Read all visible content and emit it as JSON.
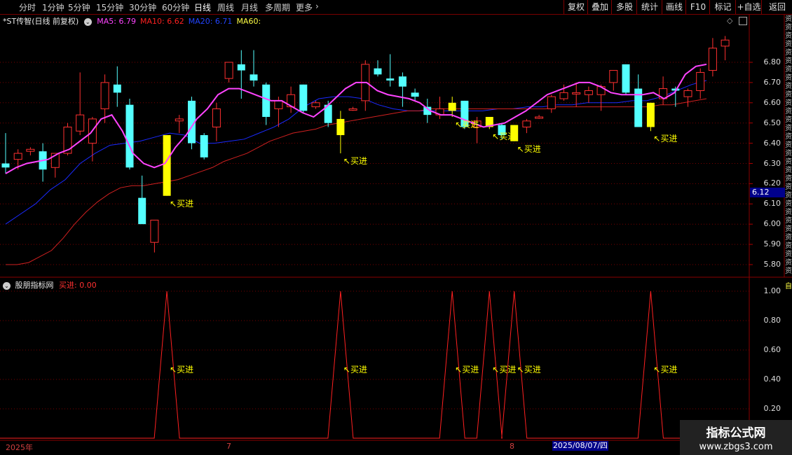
{
  "toolbar": {
    "timeframes": [
      "分时",
      "1分钟",
      "5分钟",
      "15分钟",
      "30分钟",
      "60分钟",
      "日线",
      "周线",
      "月线",
      "多周期",
      "更多"
    ],
    "right_buttons": [
      "复权",
      "叠加",
      "多股",
      "统计",
      "画线",
      "F10",
      "标记",
      "+自选",
      "返回"
    ]
  },
  "main_panel": {
    "stock_title": "*ST传智(日线 前复权)",
    "ma_legend": [
      {
        "label": "MA5: 6.79",
        "color": "#ff44ff"
      },
      {
        "label": "MA10: 6.62",
        "color": "#ff2020"
      },
      {
        "label": "MA20: 6.71",
        "color": "#2244ff"
      },
      {
        "label": "MA60:",
        "color": "#ffff44"
      }
    ],
    "price_axis": [
      "6.80",
      "6.70",
      "6.60",
      "6.50",
      "6.40",
      "6.30",
      "6.20",
      "6.10",
      "6.00",
      "5.90",
      "5.80"
    ],
    "current_price": "6.12",
    "buy_label": "↖买进",
    "right_edge_text": "资资资资资资资资资资资资资资资资资资资资资资资资资资资资资资资"
  },
  "indicator_panel": {
    "title": "股朋指标网",
    "signal_label": "买进: 0.00",
    "axis": [
      "1.00",
      "0.80",
      "0.60",
      "0.40",
      "0.20"
    ],
    "buy_label": "↖买进",
    "right_edge_text": "自"
  },
  "date_axis": {
    "labels": [
      "2025年",
      "7",
      "8"
    ],
    "highlight": "2025/08/07/四"
  },
  "watermark": {
    "line1": "指标公式网",
    "line2": "www.zbgs3.com"
  },
  "colors": {
    "up": "#ff3030",
    "down": "#54ffff",
    "signal": "#ffff00",
    "ma5": "#ff44ff",
    "ma10": "#d02020",
    "ma20": "#1a2aff",
    "grid": "#7a0000"
  },
  "chart_data": {
    "type": "candlestick",
    "candles": [
      {
        "o": 6.3,
        "h": 6.45,
        "l": 6.25,
        "c": 6.28
      },
      {
        "o": 6.32,
        "h": 6.37,
        "l": 6.27,
        "c": 6.35
      },
      {
        "o": 6.36,
        "h": 6.38,
        "l": 6.34,
        "c": 6.37
      },
      {
        "o": 6.36,
        "h": 6.4,
        "l": 6.21,
        "c": 6.27
      },
      {
        "o": 6.28,
        "h": 6.35,
        "l": 6.23,
        "c": 6.35
      },
      {
        "o": 6.35,
        "h": 6.5,
        "l": 6.34,
        "c": 6.48
      },
      {
        "o": 6.46,
        "h": 6.75,
        "l": 6.44,
        "c": 6.54
      },
      {
        "o": 6.4,
        "h": 6.53,
        "l": 6.31,
        "c": 6.52
      },
      {
        "o": 6.57,
        "h": 6.74,
        "l": 6.5,
        "c": 6.7
      },
      {
        "o": 6.69,
        "h": 6.78,
        "l": 6.58,
        "c": 6.65
      },
      {
        "o": 6.59,
        "h": 6.62,
        "l": 6.27,
        "c": 6.28
      },
      {
        "o": 6.13,
        "h": 6.24,
        "l": 6.02,
        "c": 6.0
      },
      {
        "o": 5.91,
        "h": 6.02,
        "l": 5.86,
        "c": 6.02
      },
      {
        "o": 6.44,
        "h": 6.44,
        "l": 6.14,
        "c": 6.14,
        "signal": true
      },
      {
        "o": 6.51,
        "h": 6.54,
        "l": 6.45,
        "c": 6.52
      },
      {
        "o": 6.61,
        "h": 6.63,
        "l": 6.37,
        "c": 6.4
      },
      {
        "o": 6.44,
        "h": 6.45,
        "l": 6.32,
        "c": 6.33
      },
      {
        "o": 6.48,
        "h": 6.6,
        "l": 6.41,
        "c": 6.57
      },
      {
        "o": 6.72,
        "h": 6.8,
        "l": 6.7,
        "c": 6.8
      },
      {
        "o": 6.79,
        "h": 6.86,
        "l": 6.62,
        "c": 6.76
      },
      {
        "o": 6.74,
        "h": 6.86,
        "l": 6.68,
        "c": 6.71
      },
      {
        "o": 6.69,
        "h": 6.7,
        "l": 6.49,
        "c": 6.53
      },
      {
        "o": 6.57,
        "h": 6.63,
        "l": 6.48,
        "c": 6.61
      },
      {
        "o": 6.58,
        "h": 6.68,
        "l": 6.55,
        "c": 6.64
      },
      {
        "o": 6.69,
        "h": 6.69,
        "l": 6.55,
        "c": 6.56
      },
      {
        "o": 6.58,
        "h": 6.61,
        "l": 6.57,
        "c": 6.6
      },
      {
        "o": 6.59,
        "h": 6.61,
        "l": 6.48,
        "c": 6.5
      },
      {
        "o": 6.52,
        "h": 6.56,
        "l": 6.35,
        "c": 6.44,
        "signal": true
      },
      {
        "o": 6.57,
        "h": 6.58,
        "l": 6.56,
        "c": 6.57
      },
      {
        "o": 6.61,
        "h": 6.81,
        "l": 6.56,
        "c": 6.79
      },
      {
        "o": 6.77,
        "h": 6.81,
        "l": 6.73,
        "c": 6.74
      },
      {
        "o": 6.72,
        "h": 6.84,
        "l": 6.68,
        "c": 6.71
      },
      {
        "o": 6.73,
        "h": 6.75,
        "l": 6.58,
        "c": 6.68
      },
      {
        "o": 6.65,
        "h": 6.67,
        "l": 6.61,
        "c": 6.63
      },
      {
        "o": 6.58,
        "h": 6.62,
        "l": 6.5,
        "c": 6.54
      },
      {
        "o": 6.54,
        "h": 6.63,
        "l": 6.52,
        "c": 6.57
      },
      {
        "o": 6.6,
        "h": 6.63,
        "l": 6.53,
        "c": 6.56,
        "signal": true
      },
      {
        "o": 6.61,
        "h": 6.61,
        "l": 6.47,
        "c": 6.48
      },
      {
        "o": 6.48,
        "h": 6.53,
        "l": 6.4,
        "c": 6.51
      },
      {
        "o": 6.53,
        "h": 6.53,
        "l": 6.47,
        "c": 6.48,
        "signal": true
      },
      {
        "o": 6.49,
        "h": 6.5,
        "l": 6.42,
        "c": 6.44
      },
      {
        "o": 6.49,
        "h": 6.49,
        "l": 6.41,
        "c": 6.41,
        "signal": true
      },
      {
        "o": 6.48,
        "h": 6.52,
        "l": 6.45,
        "c": 6.51
      },
      {
        "o": 6.53,
        "h": 6.54,
        "l": 6.52,
        "c": 6.53
      },
      {
        "o": 6.57,
        "h": 6.64,
        "l": 6.55,
        "c": 6.63
      },
      {
        "o": 6.62,
        "h": 6.69,
        "l": 6.61,
        "c": 6.65
      },
      {
        "o": 6.65,
        "h": 6.7,
        "l": 6.58,
        "c": 6.65
      },
      {
        "o": 6.64,
        "h": 6.68,
        "l": 6.6,
        "c": 6.66
      },
      {
        "o": 6.64,
        "h": 6.69,
        "l": 6.56,
        "c": 6.68
      },
      {
        "o": 6.7,
        "h": 6.76,
        "l": 6.66,
        "c": 6.76
      },
      {
        "o": 6.79,
        "h": 6.79,
        "l": 6.64,
        "c": 6.65
      },
      {
        "o": 6.67,
        "h": 6.74,
        "l": 6.52,
        "c": 6.48
      },
      {
        "o": 6.6,
        "h": 6.6,
        "l": 6.46,
        "c": 6.48,
        "signal": true
      },
      {
        "o": 6.62,
        "h": 6.73,
        "l": 6.59,
        "c": 6.67
      },
      {
        "o": 6.67,
        "h": 6.68,
        "l": 6.58,
        "c": 6.66
      },
      {
        "o": 6.63,
        "h": 6.67,
        "l": 6.58,
        "c": 6.66
      },
      {
        "o": 6.66,
        "h": 6.77,
        "l": 6.62,
        "c": 6.75
      },
      {
        "o": 6.76,
        "h": 6.92,
        "l": 6.73,
        "c": 6.87
      },
      {
        "o": 6.88,
        "h": 6.93,
        "l": 6.81,
        "c": 6.91
      }
    ],
    "ma5": [
      6.25,
      6.28,
      6.3,
      6.31,
      6.32,
      6.35,
      6.37,
      6.41,
      6.45,
      6.52,
      6.54,
      6.46,
      6.35,
      6.3,
      6.28,
      6.3,
      6.38,
      6.44,
      6.52,
      6.57,
      6.64,
      6.67,
      6.67,
      6.65,
      6.63,
      6.61,
      6.61,
      6.58,
      6.55,
      6.53,
      6.57,
      6.62,
      6.67,
      6.7,
      6.7,
      6.66,
      6.64,
      6.63,
      6.62,
      6.6,
      6.56,
      6.54,
      6.54,
      6.52,
      6.5,
      6.48,
      6.49,
      6.5,
      6.53,
      6.56,
      6.6,
      6.64,
      6.66,
      6.68,
      6.7,
      6.7,
      6.68,
      6.65,
      6.64,
      6.64,
      6.64,
      6.65,
      6.62,
      6.65,
      6.74,
      6.78,
      6.79
    ],
    "ma10": [
      5.8,
      5.8,
      5.81,
      5.84,
      5.87,
      5.93,
      6.0,
      6.06,
      6.11,
      6.15,
      6.18,
      6.19,
      6.19,
      6.2,
      6.21,
      6.22,
      6.24,
      6.26,
      6.28,
      6.31,
      6.33,
      6.35,
      6.38,
      6.41,
      6.43,
      6.45,
      6.46,
      6.47,
      6.49,
      6.5,
      6.51,
      6.52,
      6.53,
      6.54,
      6.55,
      6.56,
      6.56,
      6.57,
      6.57,
      6.57,
      6.57,
      6.57,
      6.57,
      6.57,
      6.57,
      6.57,
      6.57,
      6.57,
      6.58,
      6.58,
      6.58,
      6.58,
      6.58,
      6.58,
      6.58,
      6.58,
      6.58,
      6.59,
      6.59,
      6.6,
      6.61,
      6.62
    ],
    "ma20": [
      6.0,
      6.05,
      6.1,
      6.17,
      6.22,
      6.3,
      6.35,
      6.39,
      6.4,
      6.41,
      6.43,
      6.45,
      6.44,
      6.4,
      6.4,
      6.41,
      6.42,
      6.45,
      6.48,
      6.52,
      6.58,
      6.62,
      6.63,
      6.63,
      6.62,
      6.59,
      6.57,
      6.56,
      6.56,
      6.56,
      6.56,
      6.56,
      6.56,
      6.57,
      6.57,
      6.58,
      6.58,
      6.59,
      6.59,
      6.6,
      6.6,
      6.6,
      6.61,
      6.61,
      6.63,
      6.66,
      6.69,
      6.71
    ],
    "signal": {
      "range": [
        0,
        1
      ],
      "peaks_at_candle_index": [
        13,
        27,
        36,
        39,
        41,
        52
      ],
      "value": 0.0
    }
  }
}
